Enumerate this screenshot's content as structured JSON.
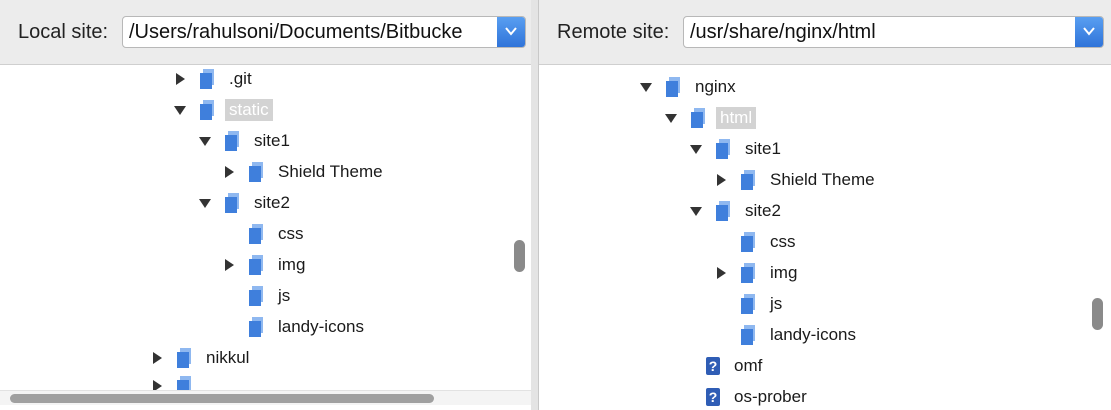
{
  "local": {
    "label": "Local site:",
    "path": "/Users/rahulsoni/Documents/Bitbucke",
    "tree": [
      {
        "key": "git",
        "label": ".git",
        "arrow": "right",
        "icon": "folder"
      },
      {
        "key": "static",
        "label": "static",
        "arrow": "down",
        "icon": "folder",
        "selected": true
      },
      {
        "key": "site1",
        "label": "site1",
        "arrow": "down",
        "icon": "folder"
      },
      {
        "key": "shield",
        "label": "Shield Theme",
        "arrow": "right",
        "icon": "folder"
      },
      {
        "key": "site2",
        "label": "site2",
        "arrow": "down",
        "icon": "folder"
      },
      {
        "key": "css",
        "label": "css",
        "arrow": "",
        "icon": "folder"
      },
      {
        "key": "img",
        "label": "img",
        "arrow": "right",
        "icon": "folder"
      },
      {
        "key": "js",
        "label": "js",
        "arrow": "",
        "icon": "folder"
      },
      {
        "key": "landy",
        "label": "landy-icons",
        "arrow": "",
        "icon": "folder"
      },
      {
        "key": "nikkul",
        "label": "nikkul",
        "arrow": "right",
        "icon": "folder"
      },
      {
        "key": "cut",
        "label": "",
        "arrow": "right",
        "icon": "folder"
      }
    ]
  },
  "remote": {
    "label": "Remote site:",
    "path": "/usr/share/nginx/html",
    "tree": [
      {
        "key": "nginx",
        "label": "nginx",
        "arrow": "down",
        "icon": "folder"
      },
      {
        "key": "html",
        "label": "html",
        "arrow": "down",
        "icon": "folder",
        "selected": true
      },
      {
        "key": "site1",
        "label": "site1",
        "arrow": "down",
        "icon": "folder"
      },
      {
        "key": "shield",
        "label": "Shield Theme",
        "arrow": "right",
        "icon": "folder"
      },
      {
        "key": "site2",
        "label": "site2",
        "arrow": "down",
        "icon": "folder"
      },
      {
        "key": "css",
        "label": "css",
        "arrow": "",
        "icon": "folder"
      },
      {
        "key": "img",
        "label": "img",
        "arrow": "right",
        "icon": "folder"
      },
      {
        "key": "js",
        "label": "js",
        "arrow": "",
        "icon": "folder"
      },
      {
        "key": "landy",
        "label": "landy-icons",
        "arrow": "",
        "icon": "folder"
      },
      {
        "key": "omf",
        "label": "omf",
        "arrow": "",
        "icon": "question"
      },
      {
        "key": "osprober",
        "label": "os-prober",
        "arrow": "",
        "icon": "question"
      }
    ]
  },
  "icons": {
    "folder_color": "#3f7fdc",
    "question_color": "#2f5db5",
    "combo_accent": "#2e72d8"
  }
}
